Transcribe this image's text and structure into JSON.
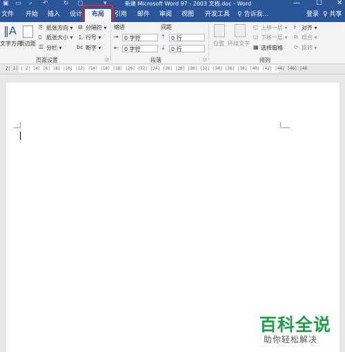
{
  "window": {
    "title": "新建 Microsoft Word 97 - 2003 文档.doc - Word",
    "minimize": "—",
    "maximize": "☐",
    "close": "✕"
  },
  "tabs": [
    {
      "label": "文件"
    },
    {
      "label": "开始"
    },
    {
      "label": "插入"
    },
    {
      "label": "设计"
    },
    {
      "label": "布局"
    },
    {
      "label": "引用"
    },
    {
      "label": "邮件"
    },
    {
      "label": "审阅"
    },
    {
      "label": "视图"
    },
    {
      "label": "开发工具"
    }
  ],
  "tell_me": "♀ 告诉我...",
  "login": "登录",
  "share": "♀ 共享",
  "ribbon": {
    "page_setup": {
      "label": "页面设置",
      "text_direction": "文字方向",
      "margins": "页边距",
      "orientation": "纸张方向 ▾",
      "size": "纸张大小 ▾",
      "columns": "分栏 ▾",
      "breaks": "分隔符 ▾",
      "line_numbers": "行号 ▾",
      "hyphenation": "断字 ▾"
    },
    "paragraph": {
      "label": "段落",
      "indent_label": "缩进",
      "spacing_label": "间距",
      "indent_left": "0 字符",
      "indent_right": "0 字符",
      "spacing_before": "0 行",
      "spacing_after": "0 行"
    },
    "arrange": {
      "label": "排列",
      "position": "位置",
      "wrap_text": "环绕文字",
      "bring_forward": "上移一层 ▾",
      "send_backward": "下移一层 ▾",
      "selection_pane": "选择窗格",
      "align": "对齐 ▾",
      "group": "组合 ▾",
      "rotate": "旋转 ▾"
    }
  },
  "ruler": {
    "ticks": "2|  1|  |  2|  |4|  |6|  |8|  |10|  |12|  |14|  |16|  |18|  |20|  |22|  |24|  |26|  |28|  |30|  |32|  |34|  |36|  |38|  |40|  |42|  |44|  |46|  |48"
  },
  "watermark": {
    "brand": "百科全说",
    "slogan": "助你轻松解决"
  },
  "colors": {
    "accent": "#2b579a",
    "highlight": "#e02424",
    "watermark": "#1e9e4a"
  }
}
